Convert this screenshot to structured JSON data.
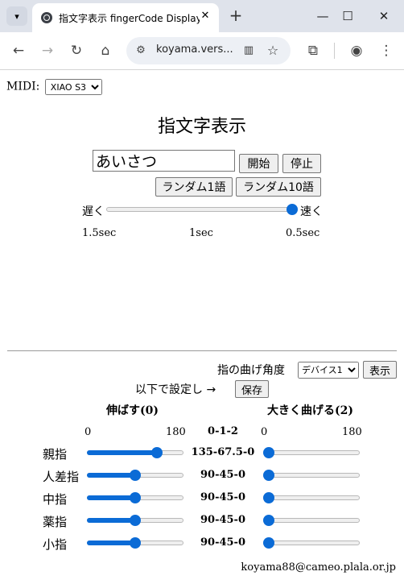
{
  "browser": {
    "tab_title": "指文字表示 fingerCode Display",
    "url": "koyama.vers...",
    "icons": [
      "tab-list-icon",
      "globe-icon",
      "close-icon",
      "plus-icon",
      "minimize-icon",
      "maximize-icon",
      "close-window-icon",
      "back-icon",
      "forward-icon",
      "reload-icon",
      "home-icon",
      "site-settings-icon",
      "reading-mode-icon",
      "star-icon",
      "extensions-icon",
      "profile-icon",
      "menu-icon"
    ]
  },
  "midi": {
    "label": "MIDI:",
    "selected": "XIAO S3"
  },
  "title": "指文字表示",
  "word": {
    "value": "あいさつ"
  },
  "buttons": {
    "start": "開始",
    "stop": "停止",
    "random1": "ランダム1語",
    "random10": "ランダム10語",
    "show": "表示",
    "save": "保存"
  },
  "speed": {
    "slow": "遅く",
    "fast": "速く",
    "tick_slow": "1.5sec",
    "tick_mid": "1sec",
    "tick_fast": "0.5sec",
    "level": 1.0
  },
  "bend": {
    "label": "指の曲げ角度",
    "device_selected": "デバイス1",
    "save_prompt": "以下で設定し →"
  },
  "columns": {
    "extend": "伸ばす(0)",
    "levels": "0-1-2",
    "bend_more": "大きく曲げる(2)",
    "min": "0",
    "max": "180"
  },
  "fingers": [
    {
      "name": "親指",
      "extend_angle": 135,
      "value": "135-67.5-0",
      "bend_angle": 0
    },
    {
      "name": "人差指",
      "extend_angle": 90,
      "value": "90-45-0",
      "bend_angle": 0
    },
    {
      "name": "中指",
      "extend_angle": 90,
      "value": "90-45-0",
      "bend_angle": 0
    },
    {
      "name": "薬指",
      "extend_angle": 90,
      "value": "90-45-0",
      "bend_angle": 0
    },
    {
      "name": "小指",
      "extend_angle": 90,
      "value": "90-45-0",
      "bend_angle": 0
    }
  ],
  "footer": {
    "email": "koyama88@cameo.plala.or.jp"
  },
  "colors": {
    "accent": "#0b6bd6",
    "chrome": "#dfe3eb"
  }
}
